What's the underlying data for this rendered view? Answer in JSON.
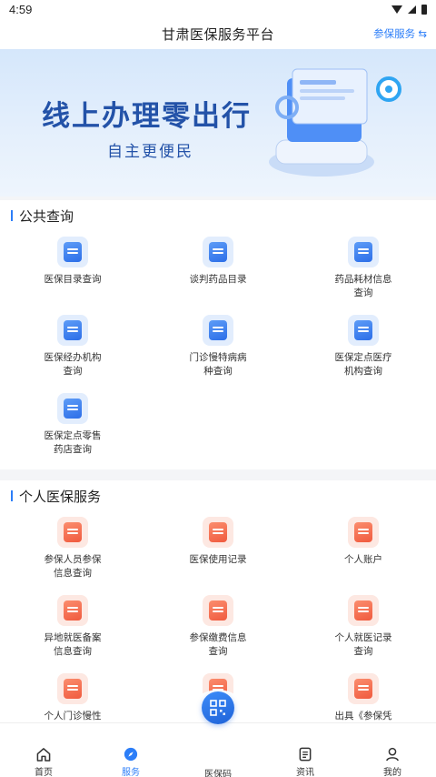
{
  "status_bar": {
    "time": "4:59"
  },
  "header": {
    "title": "甘肃医保服务平台",
    "switch_label": "参保服务 ⇆"
  },
  "banner": {
    "title": "线上办理零出行",
    "subtitle": "自主更便民"
  },
  "public_query": {
    "title": "公共查询",
    "items": [
      {
        "label": "医保目录查询",
        "icon": "catalog-search-icon"
      },
      {
        "label": "谈判药品目录",
        "icon": "drug-list-icon"
      },
      {
        "label": "药品耗材信息查询",
        "icon": "medicine-info-icon"
      },
      {
        "label": "医保经办机构查询",
        "icon": "agency-building-icon"
      },
      {
        "label": "门诊慢特病病种查询",
        "icon": "chronic-disease-icon"
      },
      {
        "label": "医保定点医疗机构查询",
        "icon": "hospital-icon"
      },
      {
        "label": "医保定点零售药店查询",
        "icon": "pharmacy-icon"
      }
    ]
  },
  "personal_service": {
    "title": "个人医保服务",
    "items": [
      {
        "label": "参保人员参保信息查询",
        "icon": "insured-info-icon"
      },
      {
        "label": "医保使用记录",
        "icon": "usage-record-icon"
      },
      {
        "label": "个人账户",
        "icon": "wallet-icon"
      },
      {
        "label": "异地就医备案信息查询",
        "icon": "remote-filing-icon"
      },
      {
        "label": "参保缴费信息查询",
        "icon": "payment-info-icon"
      },
      {
        "label": "个人就医记录查询",
        "icon": "medical-record-icon"
      },
      {
        "label": "个人门诊慢性",
        "icon": "outpatient-kit-icon"
      },
      {
        "label": "",
        "icon": "document-icon"
      },
      {
        "label": "出具《参保凭",
        "icon": "certificate-icon"
      }
    ]
  },
  "tabbar": {
    "items": [
      {
        "label": "首页",
        "icon": "home-icon"
      },
      {
        "label": "服务",
        "icon": "compass-icon"
      },
      {
        "label": "医保码",
        "icon": "qr-code-icon"
      },
      {
        "label": "资讯",
        "icon": "news-icon"
      },
      {
        "label": "我的",
        "icon": "user-icon"
      }
    ],
    "active_index": 1
  },
  "colors": {
    "accent": "#2c7ef8",
    "banner_text": "#2352a8",
    "red_icon": "#f05a3e"
  }
}
